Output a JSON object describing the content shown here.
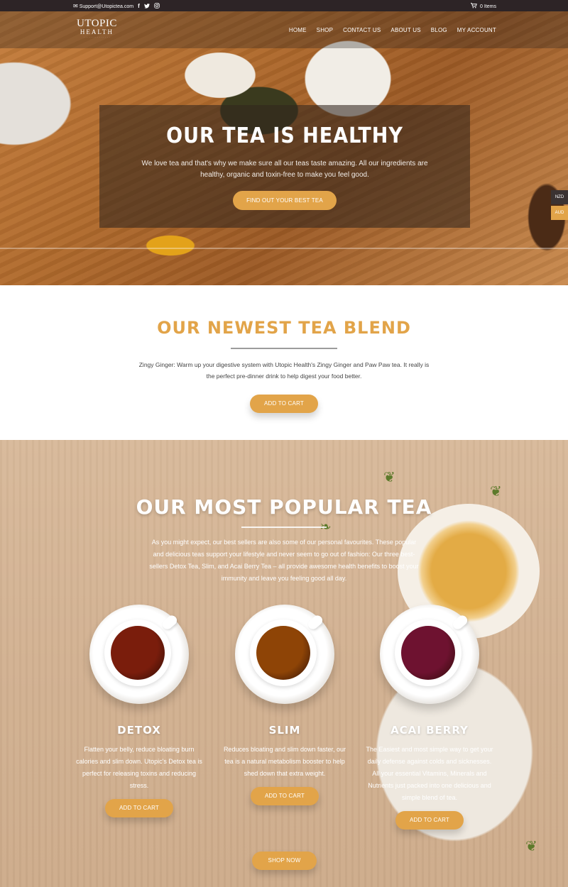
{
  "topbar": {
    "email": "Support@Utopictea.com",
    "cart": "0 Items"
  },
  "header": {
    "logo_line1": "UTOPIC",
    "logo_line2": "HEALTH",
    "nav": [
      "HOME",
      "SHOP",
      "CONTACT US",
      "ABOUT US",
      "BLOG",
      "MY ACCOUNT"
    ]
  },
  "hero": {
    "title": "OUR TEA IS HEALTHY",
    "text": "We love tea and that's why we make sure all our teas taste amazing. All our ingredients are healthy, organic and toxin-free to make you feel good.",
    "button": "FIND OUT YOUR BEST TEA"
  },
  "currency_tabs": [
    "NZD",
    "AUD"
  ],
  "newest": {
    "title": "OUR NEWEST TEA BLEND",
    "text": "Zingy Ginger: Warm up your digestive system with Utopic Health's Zingy Ginger and Paw Paw tea. It really is the perfect pre-dinner drink to help digest your food better.",
    "button": "ADD TO CART"
  },
  "popular": {
    "title": "OUR MOST POPULAR TEA",
    "intro": "As you might expect, our best sellers are also some of our personal favourites. These popular and delicious teas support your lifestyle and never seem to go out of fashion: Our three best-sellers Detox Tea, Slim, and Acai Berry Tea – all provide awesome health benefits to boost your immunity and leave you feeling good all day.",
    "products": [
      {
        "name": "DETOX",
        "text": "Flatten your belly, reduce bloating burn calories and slim down. Utopic's Detox tea is perfect for releasing toxins and reducing stress.",
        "button": "ADD TO CART",
        "color": "#7a1d0c"
      },
      {
        "name": "SLIM",
        "text": "Reduces bloating and slim down faster, our tea is a natural metabolism booster to help shed down that extra weight.",
        "button": "ADD TO CART",
        "color": "#8e4406"
      },
      {
        "name": "ACAI BERRY",
        "text": "The Easiest and most simple way to get your daily defense against colds and sicknesses. All your essential Vitamins, Minerals and Nutrients just packed into one delicious and simple blend of tea.",
        "button": "ADD TO CART",
        "color": "#6e1230"
      }
    ],
    "shop_now": "SHOP NOW"
  },
  "colors": {
    "accent": "#e2a449",
    "topbar": "#2d2426"
  }
}
